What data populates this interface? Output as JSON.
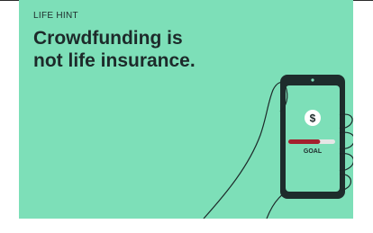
{
  "card": {
    "eyebrow": "LIFE HINT",
    "headline_line1": "Crowdfunding is",
    "headline_line2": "not life insurance."
  },
  "phone": {
    "currency_symbol": "$",
    "goal_label": "GOAL",
    "goal_progress": 0.68
  },
  "colors": {
    "background": "#7ddfb8",
    "ink": "#1d2a2a",
    "progress_fill": "#a4202d",
    "progress_track": "#e6e6e6"
  }
}
